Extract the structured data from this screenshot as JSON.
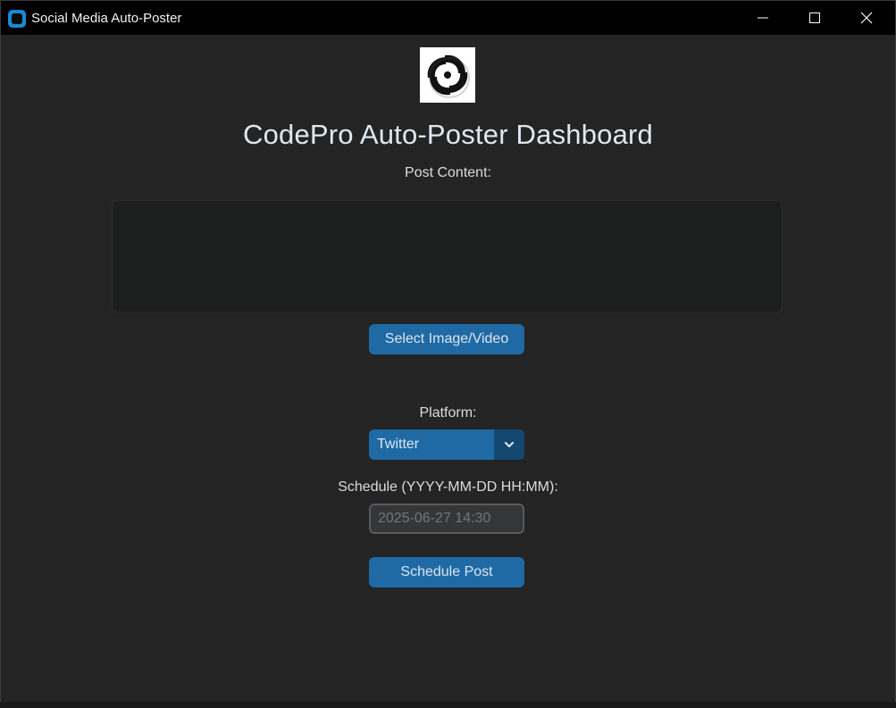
{
  "window": {
    "title": "Social Media Auto-Poster"
  },
  "icons": {
    "app": "app-icon",
    "minimize": "minimize-icon",
    "maximize": "maximize-icon",
    "close": "close-icon",
    "dropdown": "chevron-down-icon",
    "logo": "codepro-logo"
  },
  "main": {
    "heading": "CodePro Auto-Poster Dashboard",
    "post_content_label": "Post Content:",
    "post_content_value": "",
    "select_media_label": "Select Image/Video",
    "platform_label": "Platform:",
    "platform_value": "Twitter",
    "schedule_label": "Schedule (YYYY-MM-DD HH:MM):",
    "schedule_placeholder": "2025-06-27 14:30",
    "schedule_button_label": "Schedule Post"
  },
  "colors": {
    "background": "#242424",
    "titlebar": "#000000",
    "accent": "#1f6aa5",
    "accent_dark": "#144870",
    "input_bg": "#343638",
    "textbox_bg": "#1d1e1e"
  }
}
